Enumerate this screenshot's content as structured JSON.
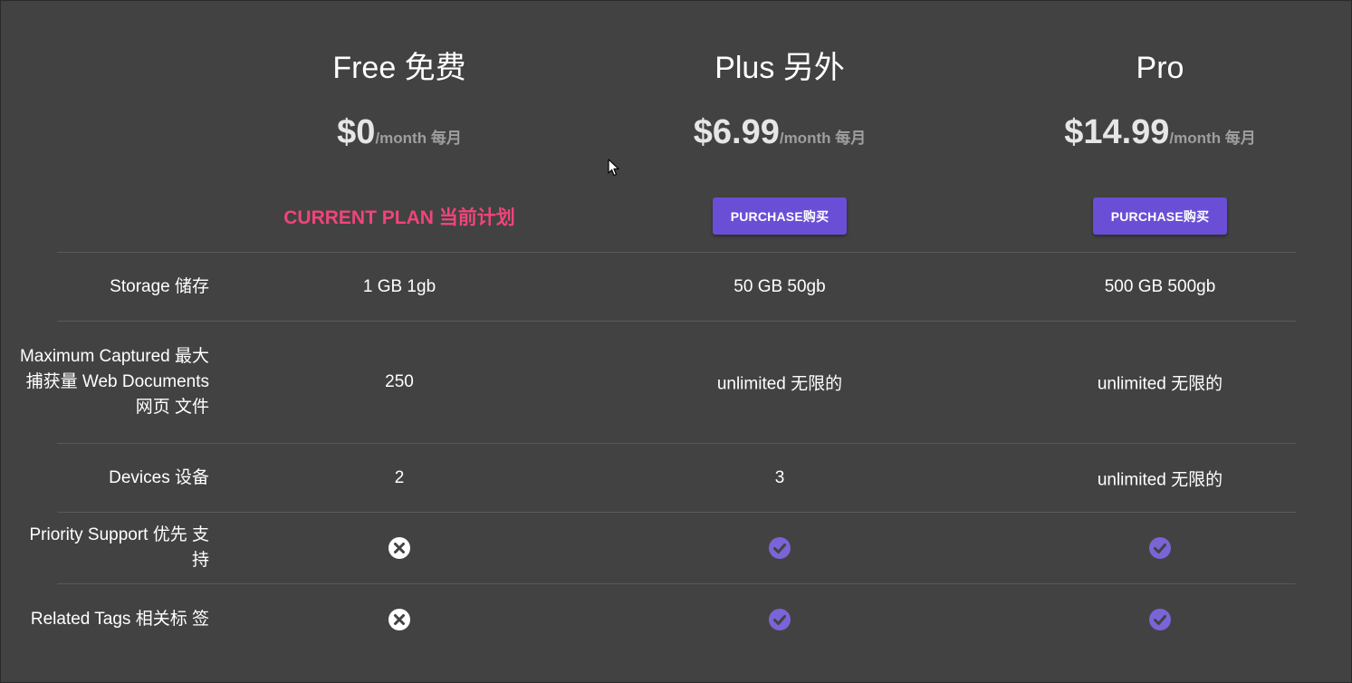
{
  "plans": [
    {
      "name": "Free 免费",
      "price": "$0",
      "period": "/month 每月",
      "action_type": "current",
      "action_label": "CURRENT PLAN 当前计划"
    },
    {
      "name": "Plus 另外",
      "price": "$6.99",
      "period": "/month 每月",
      "action_type": "button",
      "action_label": "PURCHASE购买"
    },
    {
      "name": "Pro",
      "price": "$14.99",
      "period": "/month 每月",
      "action_type": "button",
      "action_label": "PURCHASE购买"
    }
  ],
  "features": [
    {
      "label": "Storage 储存",
      "values": [
        "1 GB 1gb",
        "50 GB 50gb",
        "500 GB 500gb"
      ]
    },
    {
      "label": "Maximum Captured 最大捕获量 Web Documents 网页 文件",
      "values": [
        "250",
        "unlimited 无限的",
        "unlimited 无限的"
      ]
    },
    {
      "label": "Devices 设备",
      "values": [
        "2",
        "3",
        "unlimited 无限的"
      ]
    },
    {
      "label": "Priority Support 优先 支持",
      "icons": [
        "x-circle-icon",
        "check-circle-icon",
        "check-circle-icon"
      ]
    },
    {
      "label": "Related Tags 相关标 签",
      "icons": [
        "x-circle-icon",
        "check-circle-icon",
        "check-circle-icon"
      ]
    }
  ],
  "colors": {
    "background": "#424242",
    "accent": "#6a4fd6",
    "current_plan": "#f0457a",
    "check": "#7b64d6",
    "cross": "#ffffff"
  }
}
